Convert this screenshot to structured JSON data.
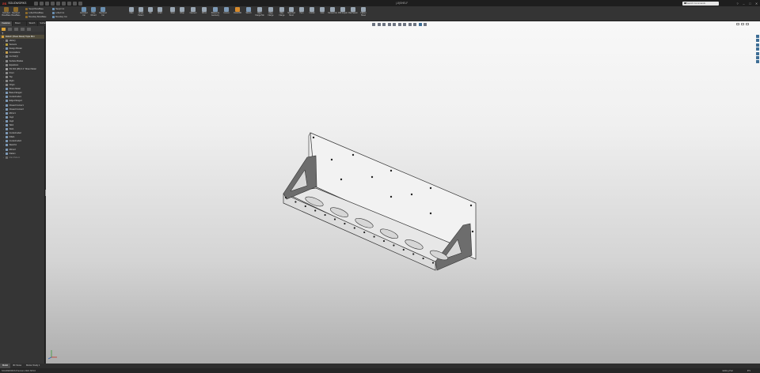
{
  "titlebar": {
    "app_name": "SOLIDWORKS",
    "document_title": "(-8)SHELF",
    "search_placeholder": "Search Commands",
    "win_buttons": [
      "?",
      "–",
      "□",
      "✕"
    ]
  },
  "commands": [
    {
      "label": "Extruded Boss/Base",
      "icon": "extrude-boss-icon",
      "color": "#8b6a2b"
    },
    {
      "label": "Revolved Boss/Base",
      "icon": "revolve-boss-icon",
      "color": "#8b6a2b"
    },
    {
      "label": "Extruded Cut",
      "icon": "extrude-cut-icon",
      "color": "#6a8fb0"
    },
    {
      "label": "Hole Wizard",
      "icon": "hole-wizard-icon",
      "color": "#6a8fb0"
    },
    {
      "label": "Revolved Cut",
      "icon": "revolve-cut-icon",
      "color": "#6a8fb0"
    },
    {
      "label": "Fillet",
      "icon": "fillet-icon",
      "color": "#9aa7b4"
    },
    {
      "label": "Linear Pattern",
      "icon": "linear-pattern-icon",
      "color": "#9aa7b4"
    },
    {
      "label": "Rib",
      "icon": "rib-icon",
      "color": "#9aa7b4"
    },
    {
      "label": "Draft",
      "icon": "draft-icon",
      "color": "#9aa7b4"
    },
    {
      "label": "Shell",
      "icon": "shell-icon",
      "color": "#9aa7b4"
    },
    {
      "label": "Wrap",
      "icon": "wrap-icon",
      "color": "#9aa7b4"
    },
    {
      "label": "Intersect",
      "icon": "intersect-icon",
      "color": "#9aa7b4"
    },
    {
      "label": "Mirror",
      "icon": "mirror-icon",
      "color": "#9aa7b4"
    },
    {
      "label": "Reference Geometry",
      "icon": "reference-geometry-icon",
      "color": "#7e9bb8"
    },
    {
      "label": "Curves",
      "icon": "curves-icon",
      "color": "#7e9bb8"
    },
    {
      "label": "Instant3D",
      "icon": "instant3d-icon",
      "color": "#d98b2b"
    },
    {
      "label": "Sketch",
      "icon": "sketch-icon",
      "color": "#7e9bb8"
    },
    {
      "label": "Base Flange/Tab",
      "icon": "base-flange-icon",
      "color": "#9aa7b4"
    },
    {
      "label": "Edge Flange",
      "icon": "edge-flange-icon",
      "color": "#9aa7b4"
    },
    {
      "label": "Miter Flange",
      "icon": "miter-flange-icon",
      "color": "#9aa7b4"
    },
    {
      "label": "Sketched Bend",
      "icon": "sketched-bend-icon",
      "color": "#9aa7b4"
    },
    {
      "label": "Hem",
      "icon": "hem-icon",
      "color": "#9aa7b4"
    },
    {
      "label": "Unfold",
      "icon": "unfold-icon",
      "color": "#9aa7b4"
    },
    {
      "label": "Fold",
      "icon": "fold-icon",
      "color": "#9aa7b4"
    },
    {
      "label": "Normal Cut",
      "icon": "normal-cut-icon",
      "color": "#9aa7b4"
    },
    {
      "label": "DXF Export",
      "icon": "dxf-export-icon",
      "color": "#9aa7b4"
    },
    {
      "label": "Flat Pattern",
      "icon": "flat-pattern-icon",
      "color": "#9aa7b4"
    },
    {
      "label": "Flatten Sheet",
      "icon": "flatten-icon",
      "color": "#9aa7b4"
    }
  ],
  "small_commands": [
    {
      "label": "Swept Boss/Base",
      "icon": "swept-icon"
    },
    {
      "label": "Lofted Boss/Base",
      "icon": "loft-icon"
    },
    {
      "label": "Boundary Boss/Base",
      "icon": "boundary-icon"
    },
    {
      "label": "Swept Cut",
      "icon": "swept-cut-icon"
    },
    {
      "label": "Lofted Cut",
      "icon": "loft-cut-icon"
    },
    {
      "label": "Boundary Cut",
      "icon": "boundary-cut-icon"
    }
  ],
  "tabs": [
    {
      "label": "Features",
      "active": true
    },
    {
      "label": "Sheet Metal",
      "active": false
    },
    {
      "label": "Sketch",
      "active": false
    },
    {
      "label": "Surfaces",
      "active": false
    },
    {
      "label": "Weldments",
      "active": false
    },
    {
      "label": "Direct Editing",
      "active": false
    },
    {
      "label": "Evaluate",
      "active": false
    },
    {
      "label": "MBD Dimensions",
      "active": false
    },
    {
      "label": "SOLIDWORKS Add-Ins",
      "active": false
    }
  ],
  "tree": {
    "root": "SHELF (Sheet Metal) Triple Brkt",
    "items": [
      {
        "label": "History",
        "icon": "history-icon",
        "color": "#8b8b8b"
      },
      {
        "label": "Sensors",
        "icon": "sensor-icon",
        "color": "#b8a040"
      },
      {
        "label": "Design Binder",
        "icon": "binder-icon",
        "color": "#7e9bb8"
      },
      {
        "label": "Annotations",
        "icon": "annotations-icon",
        "color": "#c9a24e"
      },
      {
        "label": "Cut list(1)",
        "icon": "cutlist-icon",
        "color": "#8b8b8b"
      },
      {
        "label": "Surface Bodies",
        "icon": "surface-bodies-icon",
        "color": "#8b8b8b"
      },
      {
        "label": "Equations",
        "icon": "equations-icon",
        "color": "#8b8b8b"
      },
      {
        "label": "SS 304 (2B) 0.1\" Sheet Metal",
        "icon": "material-icon",
        "color": "#a0a0a0"
      },
      {
        "label": "Front",
        "icon": "plane-icon",
        "color": "#8b8b8b"
      },
      {
        "label": "Top",
        "icon": "plane-icon",
        "color": "#8b8b8b"
      },
      {
        "label": "Right",
        "icon": "plane-icon",
        "color": "#8b8b8b"
      },
      {
        "label": "Origin",
        "icon": "origin-icon",
        "color": "#8b8b8b"
      },
      {
        "label": "Sheet-Metal",
        "icon": "sheet-metal-icon",
        "color": "#7e9bb8"
      },
      {
        "label": "Base-Flange1",
        "icon": "base-flange-icon",
        "color": "#7e9bb8"
      },
      {
        "label": "Cut-Extrude1",
        "icon": "cut-extrude-icon",
        "color": "#7e9bb8"
      },
      {
        "label": "Edge-Flange1",
        "icon": "edge-flange-icon",
        "color": "#7e9bb8"
      },
      {
        "label": "Closed Corner1",
        "icon": "corner-icon",
        "color": "#7e9bb8"
      },
      {
        "label": "Closed Corner2",
        "icon": "corner-icon",
        "color": "#7e9bb8"
      },
      {
        "label": "Mirror1",
        "icon": "mirror-icon",
        "color": "#7e9bb8"
      },
      {
        "label": "Jog1",
        "icon": "jog-icon",
        "color": "#7e9bb8"
      },
      {
        "label": "Jog2",
        "icon": "jog-icon",
        "color": "#7e9bb8"
      },
      {
        "label": "Tab1",
        "icon": "tab-icon",
        "color": "#7e9bb8"
      },
      {
        "label": "Slot1",
        "icon": "slot-icon",
        "color": "#7e9bb8"
      },
      {
        "label": "Cut-Extrude2",
        "icon": "cut-extrude-icon",
        "color": "#7e9bb8"
      },
      {
        "label": "Fillet1",
        "icon": "fillet-icon",
        "color": "#7e9bb8"
      },
      {
        "label": "Cut-Extrude3",
        "icon": "cut-extrude-icon",
        "color": "#7e9bb8"
      },
      {
        "label": "Sketch1",
        "icon": "sketch-icon",
        "color": "#7e9bb8"
      },
      {
        "label": "Mirror2",
        "icon": "mirror-icon",
        "color": "#7e9bb8"
      },
      {
        "label": "Flatten",
        "icon": "flatten-icon",
        "color": "#7e9bb8"
      },
      {
        "label": "Flat-Pattern",
        "icon": "flat-pattern-icon",
        "color": "#6b6b6b"
      }
    ]
  },
  "bottom_tabs": [
    {
      "label": "Model",
      "active": true
    },
    {
      "label": "3D Views",
      "active": false
    },
    {
      "label": "Motion Study 1",
      "active": false
    }
  ],
  "status": {
    "left": "SOLIDWORKS Premium 2021 SP4.0",
    "right": "Editing Part",
    "units": "IPS"
  },
  "heads_up_icons": [
    "zoom-fit-icon",
    "zoom-area-icon",
    "previous-view-icon",
    "section-view-icon",
    "dynamic-annotation-icon",
    "view-orientation-icon",
    "display-style-icon",
    "hide-show-icon",
    "edit-appearance-icon",
    "apply-scene-icon",
    "view-settings-icon"
  ],
  "model": {
    "shelf_holes": 6,
    "edge_holes": 16,
    "back_holes": 12
  },
  "colors": {
    "accent": "#d9a23a",
    "model_edge": "#333333"
  }
}
